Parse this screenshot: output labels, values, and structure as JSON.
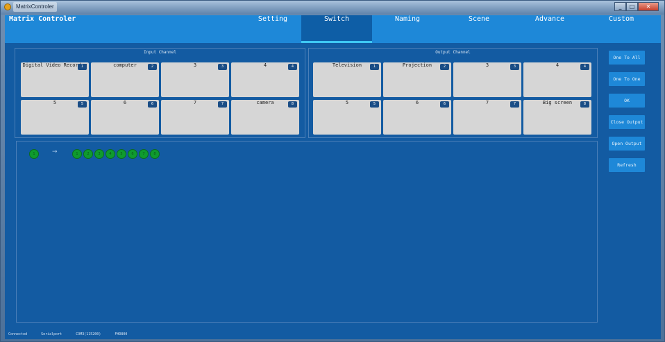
{
  "window": {
    "title": "MatrixControler"
  },
  "header": {
    "app_name": "Matrix Controler",
    "tabs": [
      {
        "label": "Setting",
        "active": false
      },
      {
        "label": "Switch",
        "active": true
      },
      {
        "label": "Naming",
        "active": false
      },
      {
        "label": "Scene",
        "active": false
      },
      {
        "label": "Advance",
        "active": false
      },
      {
        "label": "Custom",
        "active": false
      }
    ]
  },
  "input_panel": {
    "title": "Input Channel",
    "channels": [
      {
        "num": "1",
        "label": "Digital Video Recorder"
      },
      {
        "num": "2",
        "label": "computer"
      },
      {
        "num": "3",
        "label": "3"
      },
      {
        "num": "4",
        "label": "4"
      },
      {
        "num": "5",
        "label": "5"
      },
      {
        "num": "6",
        "label": "6"
      },
      {
        "num": "7",
        "label": "7"
      },
      {
        "num": "8",
        "label": "camera"
      }
    ]
  },
  "output_panel": {
    "title": "Output Channel",
    "channels": [
      {
        "num": "1",
        "label": "Television"
      },
      {
        "num": "2",
        "label": "Projection"
      },
      {
        "num": "3",
        "label": "3"
      },
      {
        "num": "4",
        "label": "4"
      },
      {
        "num": "5",
        "label": "5"
      },
      {
        "num": "6",
        "label": "6"
      },
      {
        "num": "7",
        "label": "7"
      },
      {
        "num": "8",
        "label": "Big screen"
      }
    ]
  },
  "routing": {
    "source": "1",
    "arrow": "→",
    "targets": [
      "1",
      "2",
      "3",
      "4",
      "5",
      "6",
      "7",
      "8"
    ]
  },
  "side_buttons": [
    "One To All",
    "One To One",
    "OK",
    "Close Output",
    "Open Output",
    "Refresh"
  ],
  "status": {
    "connection": "Connected",
    "port_type": "Serialport",
    "port": "COM3(115200)",
    "extra": "FHD800"
  },
  "colors": {
    "header": "#1e88d8",
    "background": "#135ba2",
    "active_tab": "#0e5ea6",
    "active_indicator": "#3ec7f2",
    "channel_card": "#d6d6d6",
    "route_dot": "#0f9b2f"
  }
}
